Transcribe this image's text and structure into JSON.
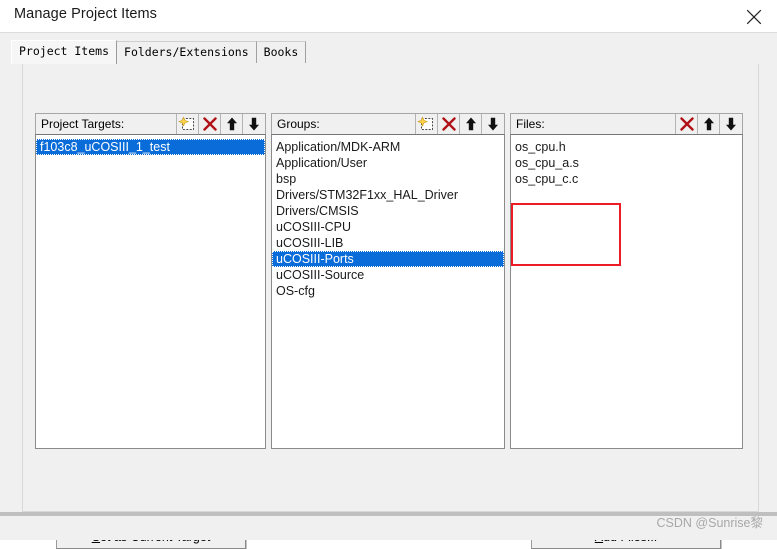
{
  "window": {
    "title": "Manage Project Items",
    "close_icon": "close-icon"
  },
  "tabs": [
    {
      "label": "Project Items",
      "active": true
    },
    {
      "label": "Folders/Extensions",
      "active": false
    },
    {
      "label": "Books",
      "active": false
    }
  ],
  "panels": {
    "targets": {
      "label": "Project Targets:",
      "tools": [
        "new-item-icon",
        "delete-icon",
        "move-up-icon",
        "move-down-icon"
      ],
      "items": [
        {
          "label": "f103c8_uCOSIII_1_test",
          "selected": true
        }
      ]
    },
    "groups": {
      "label": "Groups:",
      "tools": [
        "new-item-icon",
        "delete-icon",
        "move-up-icon",
        "move-down-icon"
      ],
      "items": [
        {
          "label": "Application/MDK-ARM",
          "selected": false
        },
        {
          "label": "Application/User",
          "selected": false
        },
        {
          "label": "bsp",
          "selected": false
        },
        {
          "label": "Drivers/STM32F1xx_HAL_Driver",
          "selected": false
        },
        {
          "label": "Drivers/CMSIS",
          "selected": false
        },
        {
          "label": "uCOSIII-CPU",
          "selected": false
        },
        {
          "label": "uCOSIII-LIB",
          "selected": false
        },
        {
          "label": "uCOSIII-Ports",
          "selected": true
        },
        {
          "label": "uCOSIII-Source",
          "selected": false
        },
        {
          "label": "OS-cfg",
          "selected": false
        }
      ]
    },
    "files": {
      "label": "Files:",
      "tools": [
        "delete-icon",
        "move-up-icon",
        "move-down-icon"
      ],
      "items": [
        {
          "label": "os_cpu.h",
          "selected": false
        },
        {
          "label": "os_cpu_a.s",
          "selected": false
        },
        {
          "label": "os_cpu_c.c",
          "selected": false
        }
      ]
    }
  },
  "buttons": {
    "set_as_current_target": {
      "accel": "S",
      "rest": "et as Current Target"
    },
    "add_files": {
      "accel": "A",
      "rest": "dd Files..."
    }
  },
  "annotation": {
    "color": "#ec1c24",
    "shape": "rectangle"
  },
  "watermark": {
    "text": "CSDN @Sunrise黎"
  },
  "colors": {
    "selection_blue": "#0a6cd8",
    "dialog_background": "#f0f0f0",
    "listbox_background": "#ffffff",
    "annotation_red": "#ec1c24",
    "delete_icon_red": "#b01217"
  }
}
